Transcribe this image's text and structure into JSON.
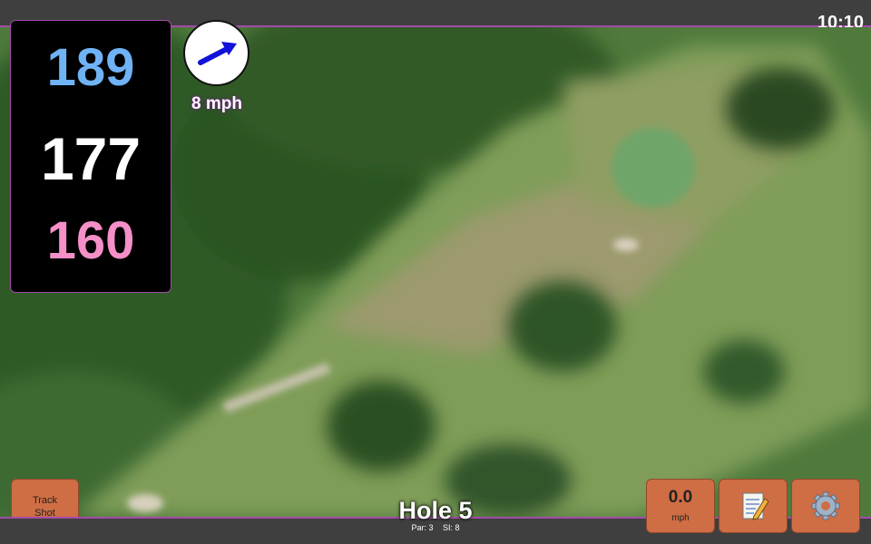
{
  "clock": "10:10",
  "distances": {
    "back": "189",
    "middle": "177",
    "front": "160"
  },
  "wind": {
    "speed_label": "8 mph",
    "direction_icon": "wind-arrow-icon"
  },
  "buttons": {
    "track_shot": "Track\nShot",
    "speed_value": "0.0",
    "speed_unit": "mph",
    "notes_icon": "notepad-icon",
    "settings_icon": "gear-icon"
  },
  "hole": {
    "title": "Hole 5",
    "par": "Par: 3",
    "si": "SI: 8"
  },
  "colors": {
    "back": "#6fb3f4",
    "middle": "#ffffff",
    "front": "#f48fc8",
    "button": "#cf6d44",
    "accent": "#a44aa8"
  }
}
